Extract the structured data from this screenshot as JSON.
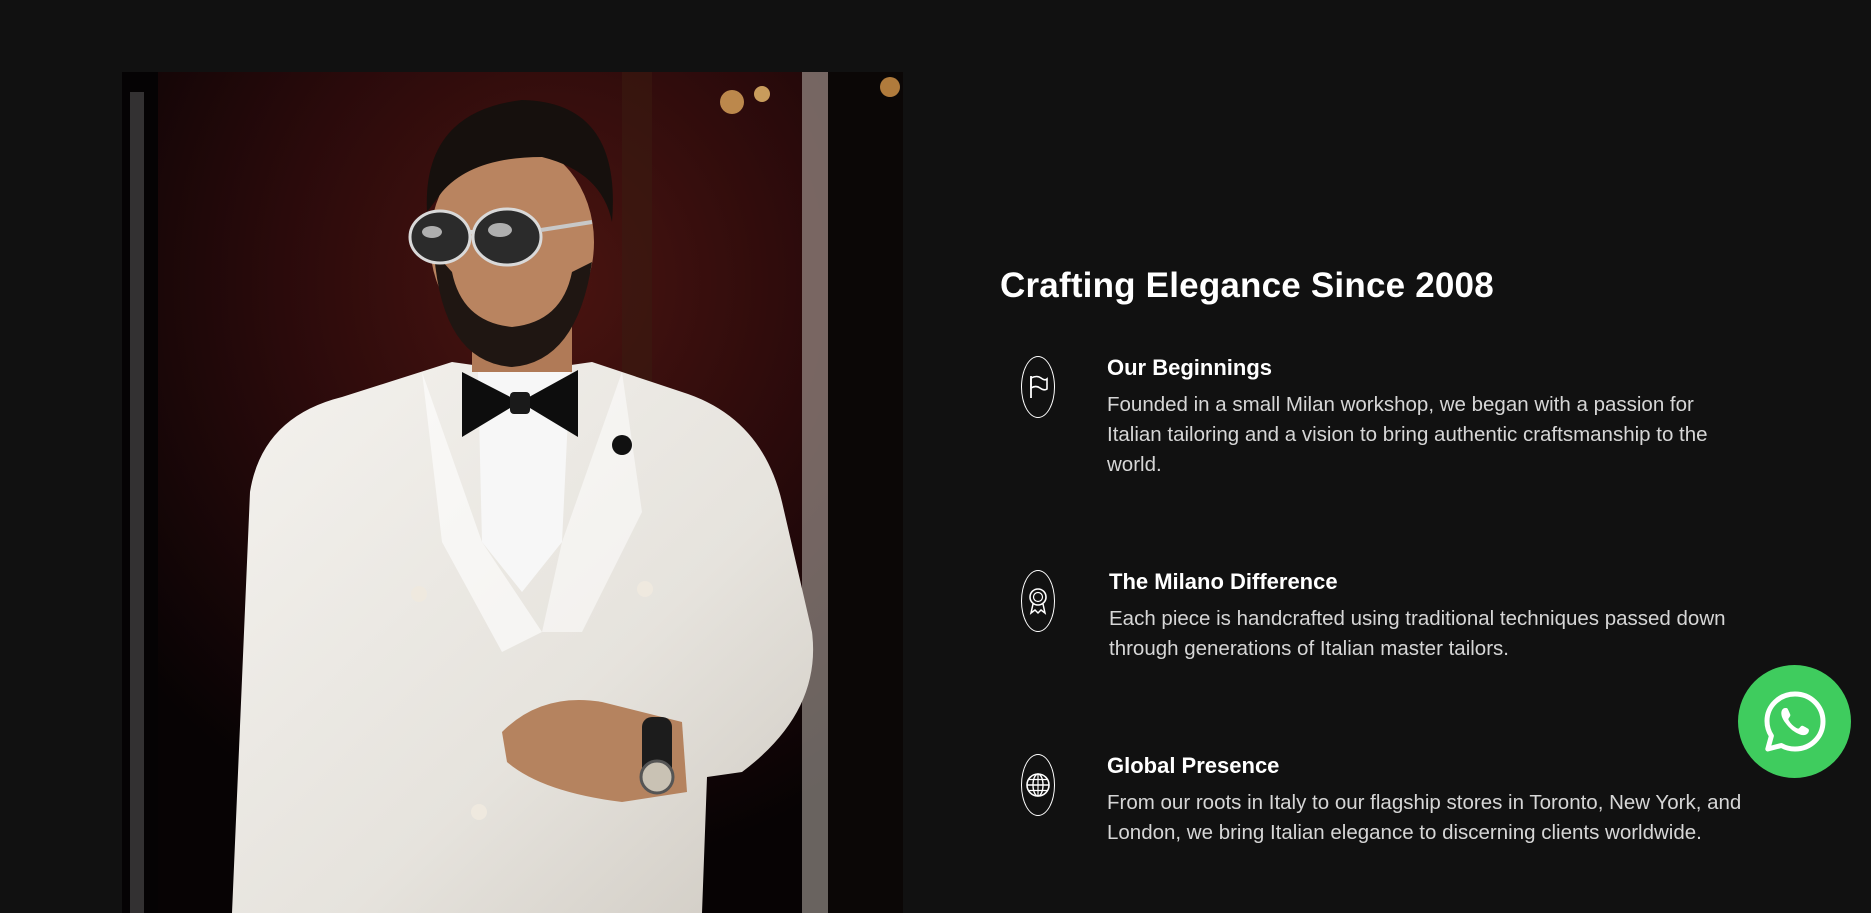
{
  "hero_image": {
    "icon": "man-in-white-tuxedo-photo"
  },
  "about": {
    "title": "Crafting Elegance Since 2008",
    "features": [
      {
        "icon": "flag-icon",
        "title": "Our Beginnings",
        "description": "Founded in a small Milan workshop, we began with a passion for Italian tailoring and a vision to bring authentic craftsmanship to the world."
      },
      {
        "icon": "award-ribbon-icon",
        "title": "The Milano Difference",
        "description": "Each piece is handcrafted using traditional techniques passed down through generations of Italian master tailors."
      },
      {
        "icon": "globe-icon",
        "title": "Global Presence",
        "description": "From our roots in Italy to our flagship stores in Toronto, New York, and London, we bring Italian elegance to discerning clients worldwide."
      }
    ]
  },
  "floating_action": {
    "icon": "whatsapp-icon",
    "color": "#3fcc5e"
  },
  "colors": {
    "background": "#111111",
    "text": "#ffffff",
    "muted_text": "#d6d6d6"
  }
}
